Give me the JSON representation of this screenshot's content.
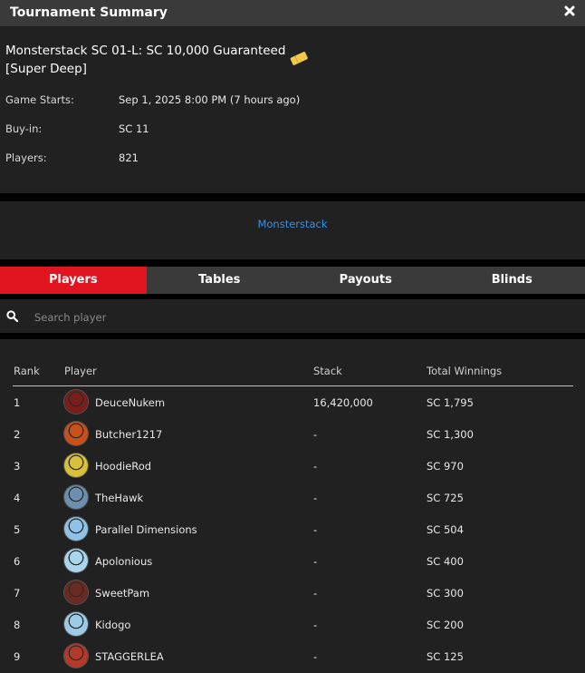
{
  "window": {
    "title": "Tournament Summary",
    "close_icon": "close-icon"
  },
  "tournament": {
    "name": "Monsterstack SC 01-L: SC 10,000 Guaranteed [Super Deep]",
    "badge_icon": "ticket-icon",
    "details": [
      {
        "label": "Game Starts:",
        "value": "Sep 1, 2025 8:00 PM (7 hours ago)"
      },
      {
        "label": "Buy-in:",
        "value": "SC 11"
      },
      {
        "label": "Players:",
        "value": "821"
      }
    ]
  },
  "promo": {
    "link_text": "Monsterstack",
    "color": "#3d8ee0"
  },
  "tabs": [
    {
      "label": "Players",
      "active": true
    },
    {
      "label": "Tables",
      "active": false
    },
    {
      "label": "Payouts",
      "active": false
    },
    {
      "label": "Blinds",
      "active": false
    }
  ],
  "search": {
    "placeholder": "Search player",
    "value": "",
    "icon": "search-icon"
  },
  "table": {
    "headers": {
      "rank": "Rank",
      "player": "Player",
      "stack": "Stack",
      "winnings": "Total Winnings"
    },
    "rows": [
      {
        "rank": "1",
        "player": "DeuceNukem",
        "stack": "16,420,000",
        "winnings": "SC 1,795",
        "avatar_color": "#7a1d1d"
      },
      {
        "rank": "2",
        "player": "Butcher1217",
        "stack": "-",
        "winnings": "SC 1,300",
        "avatar_color": "#c8501a"
      },
      {
        "rank": "3",
        "player": "HoodieRod",
        "stack": "-",
        "winnings": "SC 970",
        "avatar_color": "#d9c03a"
      },
      {
        "rank": "4",
        "player": "TheHawk",
        "stack": "-",
        "winnings": "SC 725",
        "avatar_color": "#6c8fb0"
      },
      {
        "rank": "5",
        "player": "Parallel Dimensions",
        "stack": "-",
        "winnings": "SC 504",
        "avatar_color": "#8fc2e6"
      },
      {
        "rank": "6",
        "player": "Apolonious",
        "stack": "-",
        "winnings": "SC 400",
        "avatar_color": "#a9d6ec"
      },
      {
        "rank": "7",
        "player": "SweetPam",
        "stack": "-",
        "winnings": "SC 300",
        "avatar_color": "#6b2a22"
      },
      {
        "rank": "8",
        "player": "Kidogo",
        "stack": "-",
        "winnings": "SC 200",
        "avatar_color": "#9ccbe8"
      },
      {
        "rank": "9",
        "player": "STAGGERLEA",
        "stack": "-",
        "winnings": "SC 125",
        "avatar_color": "#b33a2a"
      }
    ]
  },
  "colors": {
    "accent": "#e0151f",
    "panel": "#212121",
    "header": "#3a3a3a",
    "link": "#3d8ee0"
  }
}
